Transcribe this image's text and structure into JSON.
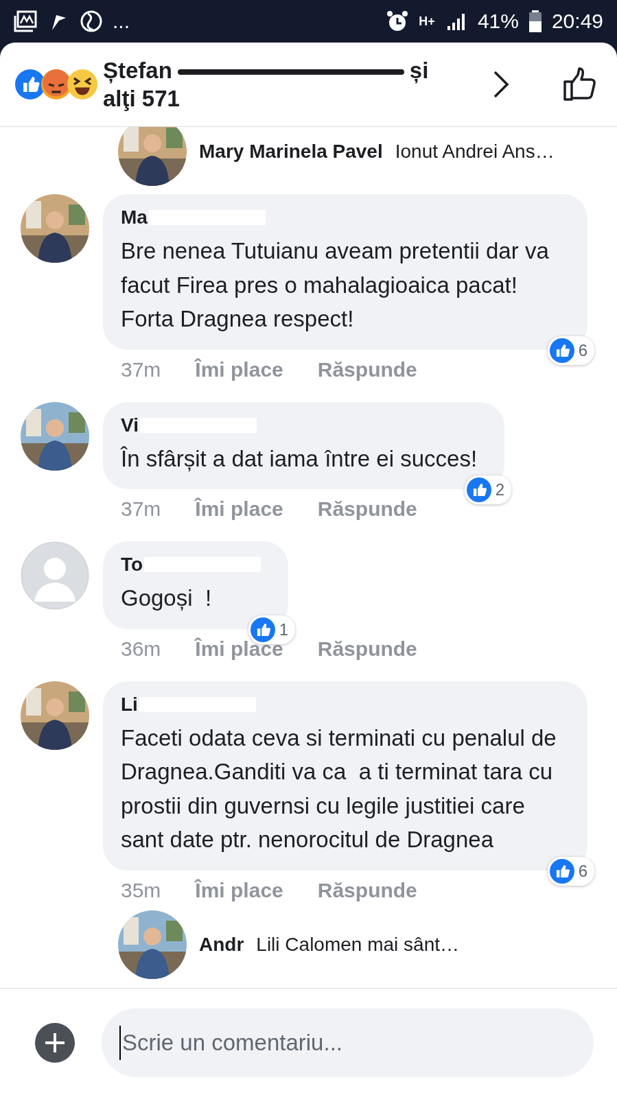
{
  "status_bar": {
    "more": "...",
    "network": "H+",
    "battery": "41%",
    "time": "20:49"
  },
  "header": {
    "title_start": "Ștefan",
    "title_end": "și",
    "title_line2": "alţi 571"
  },
  "top_reply": {
    "author": "Mary Marinela Pavel",
    "text": "Ionut Andrei Ans…"
  },
  "comments": [
    {
      "author": "Ma",
      "kind": "picture",
      "text": "Bre nenea Tutuianu aveam pretentii dar va facut Firea pres o mahalagioaica pacat! Forta Dragnea respect!",
      "time": "37m",
      "like": "Îmi place",
      "reply": "Răspunde",
      "reactions": "6"
    },
    {
      "author": "Vi",
      "kind": "picture",
      "text": "În sfârșit a dat iama între ei succes!",
      "time": "37m",
      "like": "Îmi place",
      "reply": "Răspunde",
      "reactions": "2"
    },
    {
      "author": "To",
      "kind": "placeholder",
      "text": "Gogoși  !",
      "time": "36m",
      "like": "Îmi place",
      "reply": "Răspunde",
      "reactions": "1"
    },
    {
      "author": "Li",
      "kind": "picture",
      "text": "Faceti odata ceva si terminati cu penalul de Dragnea.Ganditi va ca  a ti terminat tara cu prostii din guvernsi cu legile justitiei care sant date ptr. nenorocitul de Dragnea",
      "time": "35m",
      "like": "Îmi place",
      "reply": "Răspunde",
      "reactions": "6"
    }
  ],
  "bottom_reply": {
    "author": "Andr",
    "text": "Lili Calomen mai sânt…"
  },
  "composer": {
    "placeholder": "Scrie un comentariu..."
  }
}
